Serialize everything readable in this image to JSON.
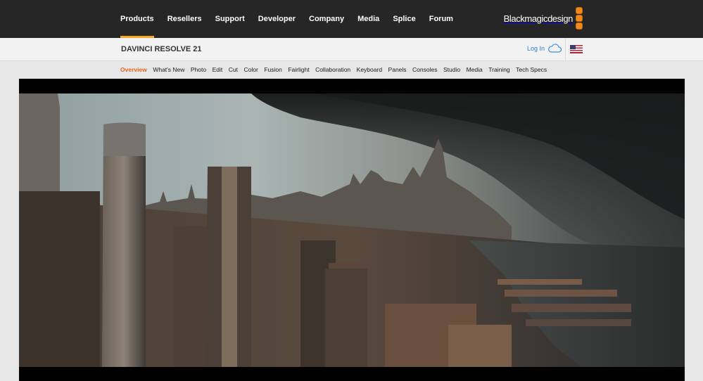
{
  "nav": {
    "items": [
      "Products",
      "Resellers",
      "Support",
      "Developer",
      "Company",
      "Media",
      "Splice",
      "Forum"
    ],
    "active_index": 0
  },
  "logo": {
    "text": "Blackmagicdesign",
    "accent_color": "#f08a1c"
  },
  "subheader": {
    "title": "DAVINCI RESOLVE 21",
    "login_label": "Log In",
    "login_icon": "cloud-icon",
    "flag_icon": "us-flag-icon"
  },
  "tabs": {
    "items": [
      "Overview",
      "What's New",
      "Photo",
      "Edit",
      "Cut",
      "Color",
      "Fusion",
      "Fairlight",
      "Collaboration",
      "Keyboard",
      "Panels",
      "Consoles",
      "Studio",
      "Media",
      "Training",
      "Tech Specs"
    ],
    "active_index": 0,
    "active_color": "#e8641d"
  },
  "hero": {
    "image_kind": "cinematic city skyline with storm clouds"
  }
}
